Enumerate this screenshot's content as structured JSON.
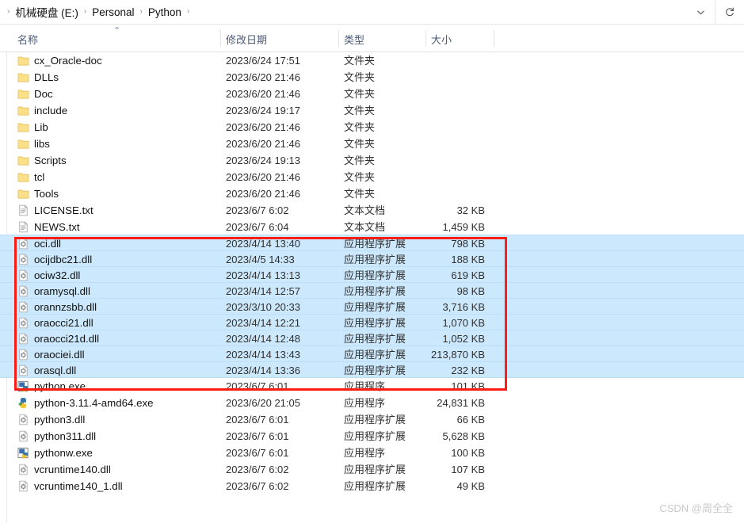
{
  "window": {
    "breadcrumb": {
      "lead_separator": "›",
      "items": [
        "机械硬盘 (E:)",
        "Personal",
        "Python"
      ],
      "separator": "›",
      "trailing_separator": "›"
    },
    "dropdown_icon": "chevron-down-icon",
    "refresh_icon": "refresh-icon"
  },
  "columns": {
    "name": "名称",
    "date_modified": "修改日期",
    "type": "类型",
    "size": "大小",
    "sort_indicator": "⌃"
  },
  "colors": {
    "selection_background": "#cce8fc",
    "selection_border": "#bcdff7",
    "annotation_red": "#fc1d15",
    "header_text": "#4a5b78",
    "folder_icon": "#f7d774",
    "watermark": "#c9c9c9"
  },
  "files": [
    {
      "name": "cx_Oracle-doc",
      "date": "2023/6/24 17:51",
      "type": "文件夹",
      "size": "",
      "icon": "folder-icon",
      "selected": false
    },
    {
      "name": "DLLs",
      "date": "2023/6/20 21:46",
      "type": "文件夹",
      "size": "",
      "icon": "folder-icon",
      "selected": false
    },
    {
      "name": "Doc",
      "date": "2023/6/20 21:46",
      "type": "文件夹",
      "size": "",
      "icon": "folder-icon",
      "selected": false
    },
    {
      "name": "include",
      "date": "2023/6/24 19:17",
      "type": "文件夹",
      "size": "",
      "icon": "folder-icon",
      "selected": false
    },
    {
      "name": "Lib",
      "date": "2023/6/20 21:46",
      "type": "文件夹",
      "size": "",
      "icon": "folder-icon",
      "selected": false
    },
    {
      "name": "libs",
      "date": "2023/6/20 21:46",
      "type": "文件夹",
      "size": "",
      "icon": "folder-icon",
      "selected": false
    },
    {
      "name": "Scripts",
      "date": "2023/6/24 19:13",
      "type": "文件夹",
      "size": "",
      "icon": "folder-icon",
      "selected": false
    },
    {
      "name": "tcl",
      "date": "2023/6/20 21:46",
      "type": "文件夹",
      "size": "",
      "icon": "folder-icon",
      "selected": false
    },
    {
      "name": "Tools",
      "date": "2023/6/20 21:46",
      "type": "文件夹",
      "size": "",
      "icon": "folder-icon",
      "selected": false
    },
    {
      "name": "LICENSE.txt",
      "date": "2023/6/7 6:02",
      "type": "文本文档",
      "size": "32 KB",
      "icon": "text-file-icon",
      "selected": false
    },
    {
      "name": "NEWS.txt",
      "date": "2023/6/7 6:04",
      "type": "文本文档",
      "size": "1,459 KB",
      "icon": "text-file-icon",
      "selected": false
    },
    {
      "name": "oci.dll",
      "date": "2023/4/14 13:40",
      "type": "应用程序扩展",
      "size": "798 KB",
      "icon": "dll-file-icon",
      "selected": true
    },
    {
      "name": "ocijdbc21.dll",
      "date": "2023/4/5 14:33",
      "type": "应用程序扩展",
      "size": "188 KB",
      "icon": "dll-file-icon",
      "selected": true
    },
    {
      "name": "ociw32.dll",
      "date": "2023/4/14 13:13",
      "type": "应用程序扩展",
      "size": "619 KB",
      "icon": "dll-file-icon",
      "selected": true
    },
    {
      "name": "oramysql.dll",
      "date": "2023/4/14 12:57",
      "type": "应用程序扩展",
      "size": "98 KB",
      "icon": "dll-file-icon",
      "selected": true
    },
    {
      "name": "orannzsbb.dll",
      "date": "2023/3/10 20:33",
      "type": "应用程序扩展",
      "size": "3,716 KB",
      "icon": "dll-file-icon",
      "selected": true
    },
    {
      "name": "oraocci21.dll",
      "date": "2023/4/14 12:21",
      "type": "应用程序扩展",
      "size": "1,070 KB",
      "icon": "dll-file-icon",
      "selected": true
    },
    {
      "name": "oraocci21d.dll",
      "date": "2023/4/14 12:48",
      "type": "应用程序扩展",
      "size": "1,052 KB",
      "icon": "dll-file-icon",
      "selected": true
    },
    {
      "name": "oraociei.dll",
      "date": "2023/4/14 13:43",
      "type": "应用程序扩展",
      "size": "213,870 KB",
      "icon": "dll-file-icon",
      "selected": true
    },
    {
      "name": "orasql.dll",
      "date": "2023/4/14 13:36",
      "type": "应用程序扩展",
      "size": "232 KB",
      "icon": "dll-file-icon",
      "selected": true
    },
    {
      "name": "python.exe",
      "date": "2023/6/7 6:01",
      "type": "应用程序",
      "size": "101 KB",
      "icon": "python-exe-icon",
      "selected": false
    },
    {
      "name": "python-3.11.4-amd64.exe",
      "date": "2023/6/20 21:05",
      "type": "应用程序",
      "size": "24,831 KB",
      "icon": "python-installer-icon",
      "selected": false
    },
    {
      "name": "python3.dll",
      "date": "2023/6/7 6:01",
      "type": "应用程序扩展",
      "size": "66 KB",
      "icon": "dll-file-icon",
      "selected": false
    },
    {
      "name": "python311.dll",
      "date": "2023/6/7 6:01",
      "type": "应用程序扩展",
      "size": "5,628 KB",
      "icon": "dll-file-icon",
      "selected": false
    },
    {
      "name": "pythonw.exe",
      "date": "2023/6/7 6:01",
      "type": "应用程序",
      "size": "100 KB",
      "icon": "python-exe-icon",
      "selected": false
    },
    {
      "name": "vcruntime140.dll",
      "date": "2023/6/7 6:02",
      "type": "应用程序扩展",
      "size": "107 KB",
      "icon": "dll-file-icon",
      "selected": false
    },
    {
      "name": "vcruntime140_1.dll",
      "date": "2023/6/7 6:02",
      "type": "应用程序扩展",
      "size": "49 KB",
      "icon": "dll-file-icon",
      "selected": false
    }
  ],
  "annotation": {
    "shape": "rectangle",
    "color": "#fc1d15",
    "covers_rows": [
      "oci.dll",
      "ocijdbc21.dll",
      "ociw32.dll",
      "oramysql.dll",
      "orannzsbb.dll",
      "oraocci21.dll",
      "oraocci21d.dll",
      "oraociei.dll",
      "orasql.dll"
    ]
  },
  "watermark": "CSDN @周全全"
}
